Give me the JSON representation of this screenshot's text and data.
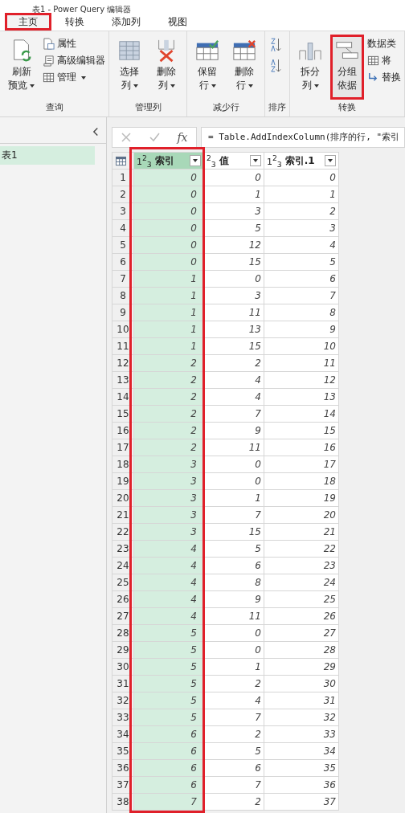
{
  "window": {
    "title": "表1 - Power Query 编辑器"
  },
  "tabs": [
    {
      "label": "主页",
      "selected": true,
      "highlighted": true
    },
    {
      "label": "转换",
      "selected": false,
      "highlighted": false
    },
    {
      "label": "添加列",
      "selected": false,
      "highlighted": false
    },
    {
      "label": "视图",
      "selected": false,
      "highlighted": false
    }
  ],
  "ribbon": {
    "groups": [
      {
        "label": "查询",
        "items": [
          {
            "kind": "big",
            "lines": [
              "刷新",
              "预览"
            ],
            "dropdown": true,
            "highlighted": false
          },
          {
            "kind": "stack",
            "entries": [
              {
                "label": "属性",
                "dropdown": false
              },
              {
                "label": "高级编辑器",
                "dropdown": false
              },
              {
                "label": "管理",
                "dropdown": true
              }
            ]
          }
        ]
      },
      {
        "label": "管理列",
        "items": [
          {
            "kind": "big",
            "lines": [
              "选择",
              "列"
            ],
            "dropdown": true,
            "highlighted": false
          },
          {
            "kind": "big",
            "lines": [
              "删除",
              "列"
            ],
            "dropdown": true,
            "highlighted": false
          }
        ]
      },
      {
        "label": "减少行",
        "items": [
          {
            "kind": "big",
            "lines": [
              "保留",
              "行"
            ],
            "dropdown": true,
            "highlighted": false
          },
          {
            "kind": "big",
            "lines": [
              "删除",
              "行"
            ],
            "dropdown": true,
            "highlighted": false
          }
        ]
      },
      {
        "label": "排序",
        "items": [
          {
            "kind": "sort"
          }
        ]
      },
      {
        "label": "转换",
        "items": [
          {
            "kind": "big",
            "lines": [
              "拆分",
              "列"
            ],
            "dropdown": true,
            "highlighted": false
          },
          {
            "kind": "big",
            "lines": [
              "分组",
              "依据"
            ],
            "dropdown": false,
            "highlighted": true
          },
          {
            "kind": "stack",
            "entries": [
              {
                "label": "数据类",
                "dropdown": false
              },
              {
                "label": "将",
                "dropdown": false
              },
              {
                "label": "替换",
                "dropdown": false
              }
            ]
          }
        ]
      }
    ]
  },
  "queries": {
    "items": [
      {
        "label": "表1",
        "selected": true
      }
    ]
  },
  "formula_bar": {
    "function_label": "fx",
    "formula": "= Table.AddIndexColumn(排序的行, \"索引"
  },
  "table": {
    "columns": [
      {
        "type_label": "1$^{2}$$_{3}$",
        "name": "索引",
        "selected": true,
        "highlighted": true
      },
      {
        "type_label": "$^{2}$$_{3}$",
        "name": "值",
        "selected": false,
        "highlighted": false
      },
      {
        "type_label": "1$^{2}$$_{3}$",
        "name": "索引.1",
        "selected": false,
        "highlighted": false
      }
    ],
    "rows": [
      {
        "num": "1",
        "cells": [
          "0",
          "0",
          "0"
        ]
      },
      {
        "num": "2",
        "cells": [
          "0",
          "1",
          "1"
        ]
      },
      {
        "num": "3",
        "cells": [
          "0",
          "3",
          "2"
        ]
      },
      {
        "num": "4",
        "cells": [
          "0",
          "5",
          "3"
        ]
      },
      {
        "num": "5",
        "cells": [
          "0",
          "12",
          "4"
        ]
      },
      {
        "num": "6",
        "cells": [
          "0",
          "15",
          "5"
        ]
      },
      {
        "num": "7",
        "cells": [
          "1",
          "0",
          "6"
        ]
      },
      {
        "num": "8",
        "cells": [
          "1",
          "3",
          "7"
        ]
      },
      {
        "num": "9",
        "cells": [
          "1",
          "11",
          "8"
        ]
      },
      {
        "num": "10",
        "cells": [
          "1",
          "13",
          "9"
        ]
      },
      {
        "num": "11",
        "cells": [
          "1",
          "15",
          "10"
        ]
      },
      {
        "num": "12",
        "cells": [
          "2",
          "2",
          "11"
        ]
      },
      {
        "num": "13",
        "cells": [
          "2",
          "4",
          "12"
        ]
      },
      {
        "num": "14",
        "cells": [
          "2",
          "4",
          "13"
        ]
      },
      {
        "num": "15",
        "cells": [
          "2",
          "7",
          "14"
        ]
      },
      {
        "num": "16",
        "cells": [
          "2",
          "9",
          "15"
        ]
      },
      {
        "num": "17",
        "cells": [
          "2",
          "11",
          "16"
        ]
      },
      {
        "num": "18",
        "cells": [
          "3",
          "0",
          "17"
        ]
      },
      {
        "num": "19",
        "cells": [
          "3",
          "0",
          "18"
        ]
      },
      {
        "num": "20",
        "cells": [
          "3",
          "1",
          "19"
        ]
      },
      {
        "num": "21",
        "cells": [
          "3",
          "7",
          "20"
        ]
      },
      {
        "num": "22",
        "cells": [
          "3",
          "15",
          "21"
        ]
      },
      {
        "num": "23",
        "cells": [
          "4",
          "5",
          "22"
        ]
      },
      {
        "num": "24",
        "cells": [
          "4",
          "6",
          "23"
        ]
      },
      {
        "num": "25",
        "cells": [
          "4",
          "8",
          "24"
        ]
      },
      {
        "num": "26",
        "cells": [
          "4",
          "9",
          "25"
        ]
      },
      {
        "num": "27",
        "cells": [
          "4",
          "11",
          "26"
        ]
      },
      {
        "num": "28",
        "cells": [
          "5",
          "0",
          "27"
        ]
      },
      {
        "num": "29",
        "cells": [
          "5",
          "0",
          "28"
        ]
      },
      {
        "num": "30",
        "cells": [
          "5",
          "1",
          "29"
        ]
      },
      {
        "num": "31",
        "cells": [
          "5",
          "2",
          "30"
        ]
      },
      {
        "num": "32",
        "cells": [
          "5",
          "4",
          "31"
        ]
      },
      {
        "num": "33",
        "cells": [
          "5",
          "7",
          "32"
        ]
      },
      {
        "num": "34",
        "cells": [
          "6",
          "2",
          "33"
        ]
      },
      {
        "num": "35",
        "cells": [
          "6",
          "5",
          "34"
        ]
      },
      {
        "num": "36",
        "cells": [
          "6",
          "6",
          "35"
        ]
      },
      {
        "num": "37",
        "cells": [
          "6",
          "7",
          "36"
        ]
      },
      {
        "num": "38",
        "cells": [
          "7",
          "2",
          "37"
        ]
      }
    ]
  }
}
